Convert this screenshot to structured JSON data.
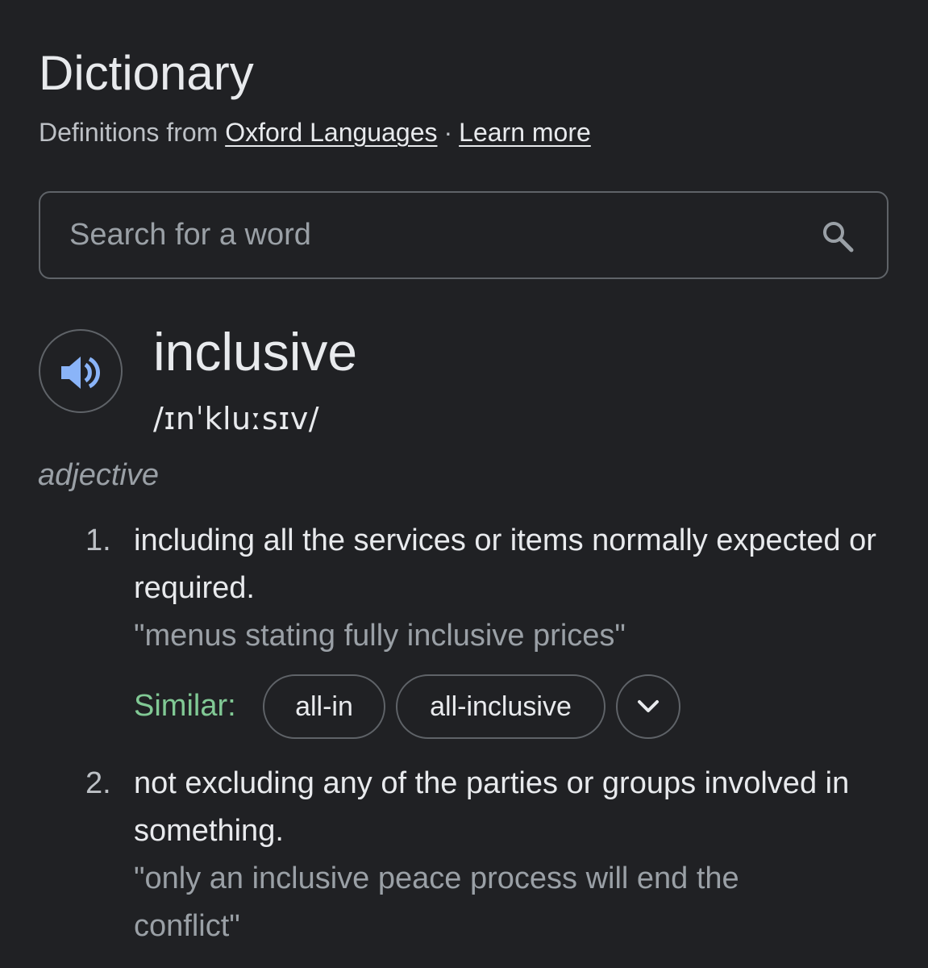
{
  "header": {
    "title": "Dictionary",
    "source_prefix": "Definitions from",
    "source_link": "Oxford Languages",
    "separator": "·",
    "learn_more": "Learn more"
  },
  "search": {
    "placeholder": "Search for a word",
    "value": ""
  },
  "entry": {
    "word": "inclusive",
    "phonetic": "/ɪnˈkluːsɪv/",
    "part_of_speech": "adjective",
    "senses": [
      {
        "number": "1.",
        "definition": "including all the services or items normally expected or required.",
        "example": "\"menus stating fully inclusive prices\"",
        "similar_label": "Similar:",
        "similar": [
          "all-in",
          "all-inclusive"
        ]
      },
      {
        "number": "2.",
        "definition": "not excluding any of the parties or groups involved in something.",
        "example": "\"only an inclusive peace process will end the conflict\""
      }
    ]
  },
  "colors": {
    "background": "#202124",
    "text": "#e8eaed",
    "muted": "#9aa0a6",
    "similar": "#81c995",
    "audio_icon": "#8ab4f8",
    "border": "#5f6368"
  },
  "icons": {
    "search": "search-icon",
    "audio": "speaker-icon",
    "expand": "chevron-down-icon"
  }
}
